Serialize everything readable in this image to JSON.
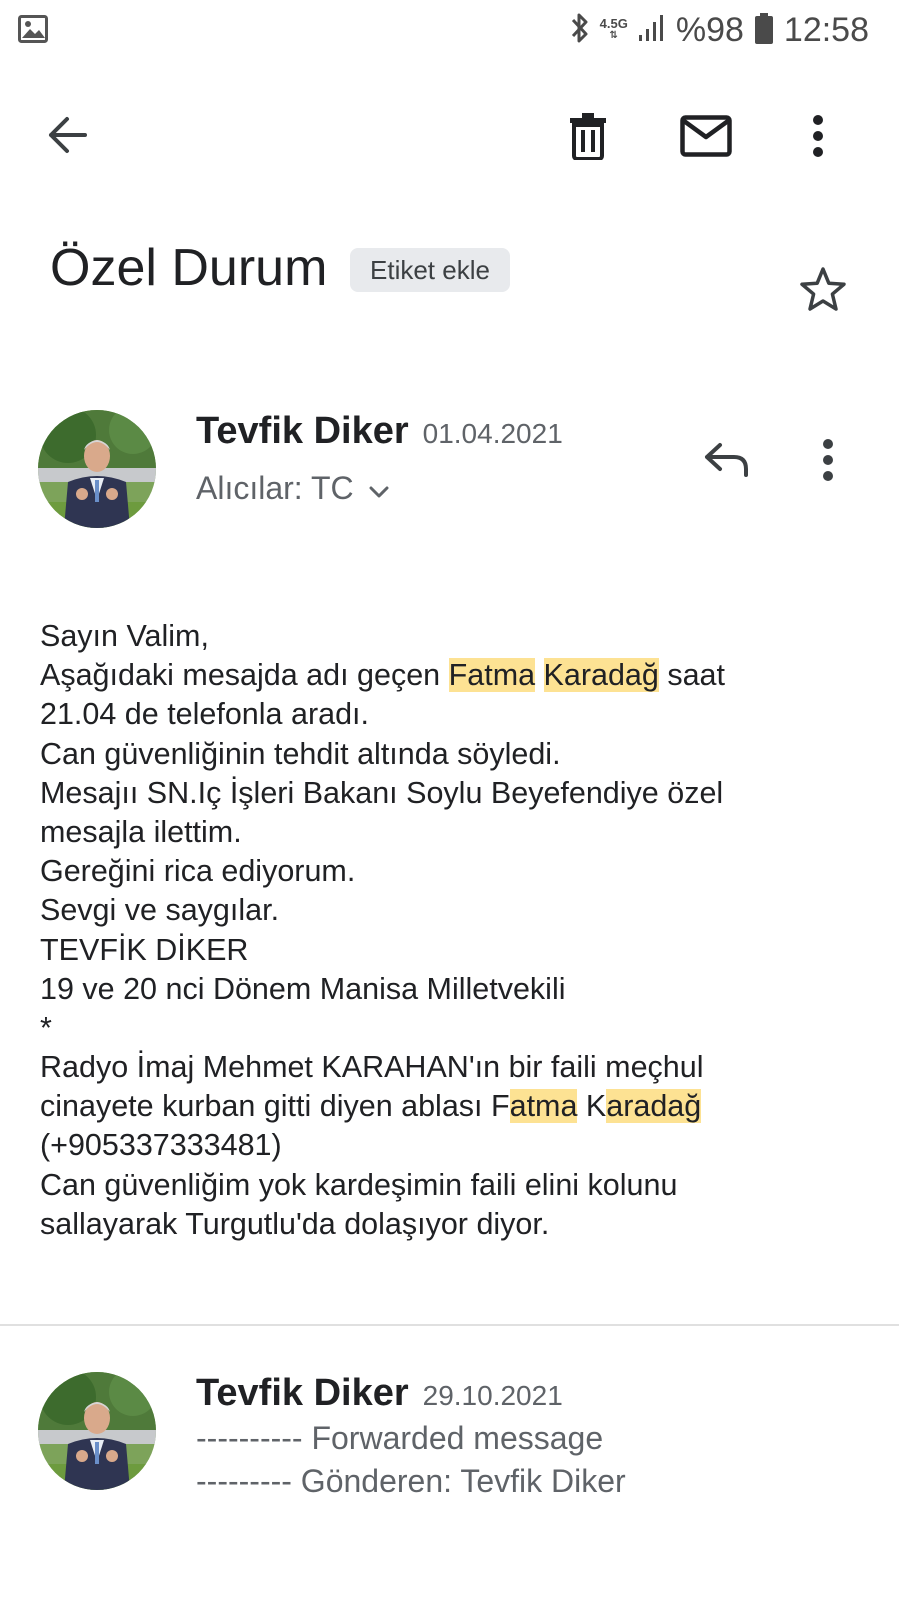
{
  "status_bar": {
    "network_type": "4.5G",
    "battery": "%98",
    "time": "12:58"
  },
  "toolbar": {
    "icons": [
      "back-arrow-icon",
      "delete-icon",
      "mark-unread-icon",
      "more-vert-icon"
    ]
  },
  "subject": {
    "title": "Özel Durum",
    "label_chip": "Etiket ekle"
  },
  "messages": [
    {
      "sender": "Tevfik Diker",
      "date": "01.04.2021",
      "recipients": "Alıcılar: TC",
      "body": {
        "l1": "Sayın Valim,",
        "l2a": "Aşağıdaki mesajda adı geçen ",
        "l2b": "Fatma",
        "l2c": " ",
        "l2d": "Karadağ",
        "l2e": " saat",
        "l3": "21.04 de telefonla aradı.",
        "l4": "Can güvenliğinin tehdit altında söyledi.",
        "l5": "Mesajıı SN.Iç İşleri Bakanı Soylu Beyefendiye özel",
        "l6": "mesajla ilettim.",
        "l7": "Gereğini rica ediyorum.",
        "l8": "Sevgi ve saygılar.",
        "l9": "TEVFİK DİKER",
        "l10": "19 ve  20 nci  Dönem  Manisa Milletvekili",
        "l11": "*",
        "l12": "Radyo İmaj Mehmet KARAHAN'ın bir faili meçhul",
        "l13a": "cinayete kurban gitti diyen ablası F",
        "l13b": "atma",
        "l13c": " K",
        "l13d": "aradağ",
        "l14": "(+905337333481)",
        "l15": "Can güvenliğim yok  kardeşimin faili elini kolunu",
        "l16": "sallayarak Turgutlu'da dolaşıyor diyor."
      }
    },
    {
      "sender": "Tevfik Diker",
      "date": "29.10.2021",
      "snippet_1": "---------- Forwarded message",
      "snippet_2": "--------- Gönderen: Tevfik Diker"
    }
  ],
  "colors": {
    "highlight": "#fde293",
    "chip_bg": "#e8eaed",
    "text_primary": "#202124",
    "text_secondary": "#5f6368"
  }
}
